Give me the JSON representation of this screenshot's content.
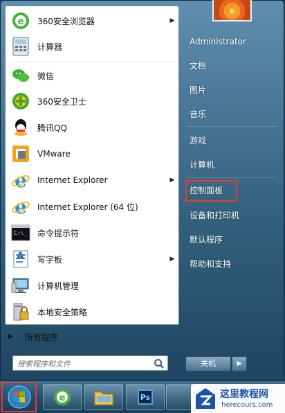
{
  "programs": [
    {
      "label": "360安全浏览器",
      "has_arrow": true,
      "icon": "360-browser-icon"
    },
    {
      "label": "计算器",
      "has_arrow": false,
      "icon": "calculator-icon"
    },
    {
      "label": "微信",
      "has_arrow": false,
      "icon": "wechat-icon"
    },
    {
      "label": "360安全卫士",
      "has_arrow": false,
      "icon": "360-safe-icon"
    },
    {
      "label": "腾讯QQ",
      "has_arrow": false,
      "icon": "qq-icon"
    },
    {
      "label": "VMware",
      "has_arrow": false,
      "icon": "vmware-icon"
    },
    {
      "label": "Internet Explorer",
      "has_arrow": true,
      "icon": "ie-icon"
    },
    {
      "label": "Internet Explorer (64 位)",
      "has_arrow": false,
      "icon": "ie64-icon"
    },
    {
      "label": "命令提示符",
      "has_arrow": false,
      "icon": "cmd-icon"
    },
    {
      "label": "写字板",
      "has_arrow": true,
      "icon": "wordpad-icon"
    },
    {
      "label": "计算机管理",
      "has_arrow": false,
      "icon": "computer-management-icon"
    },
    {
      "label": "本地安全策略",
      "has_arrow": false,
      "icon": "security-policy-icon"
    }
  ],
  "all_programs": "所有程序",
  "search": {
    "placeholder": "搜索程序和文件"
  },
  "right_panel": {
    "user": "Administrator",
    "items": [
      "文档",
      "图片",
      "音乐",
      "游戏",
      "计算机",
      "控制面板",
      "设备和打印机",
      "默认程序",
      "帮助和支持"
    ],
    "highlighted": "控制面板"
  },
  "shutdown": {
    "label": "关机",
    "arrow": "▶"
  },
  "watermark": {
    "title": "这里教程网",
    "url": "herecours.com"
  },
  "colors": {
    "highlight": "#e53935",
    "menu_frame": "#34627f",
    "taskbar": "#21506f"
  }
}
